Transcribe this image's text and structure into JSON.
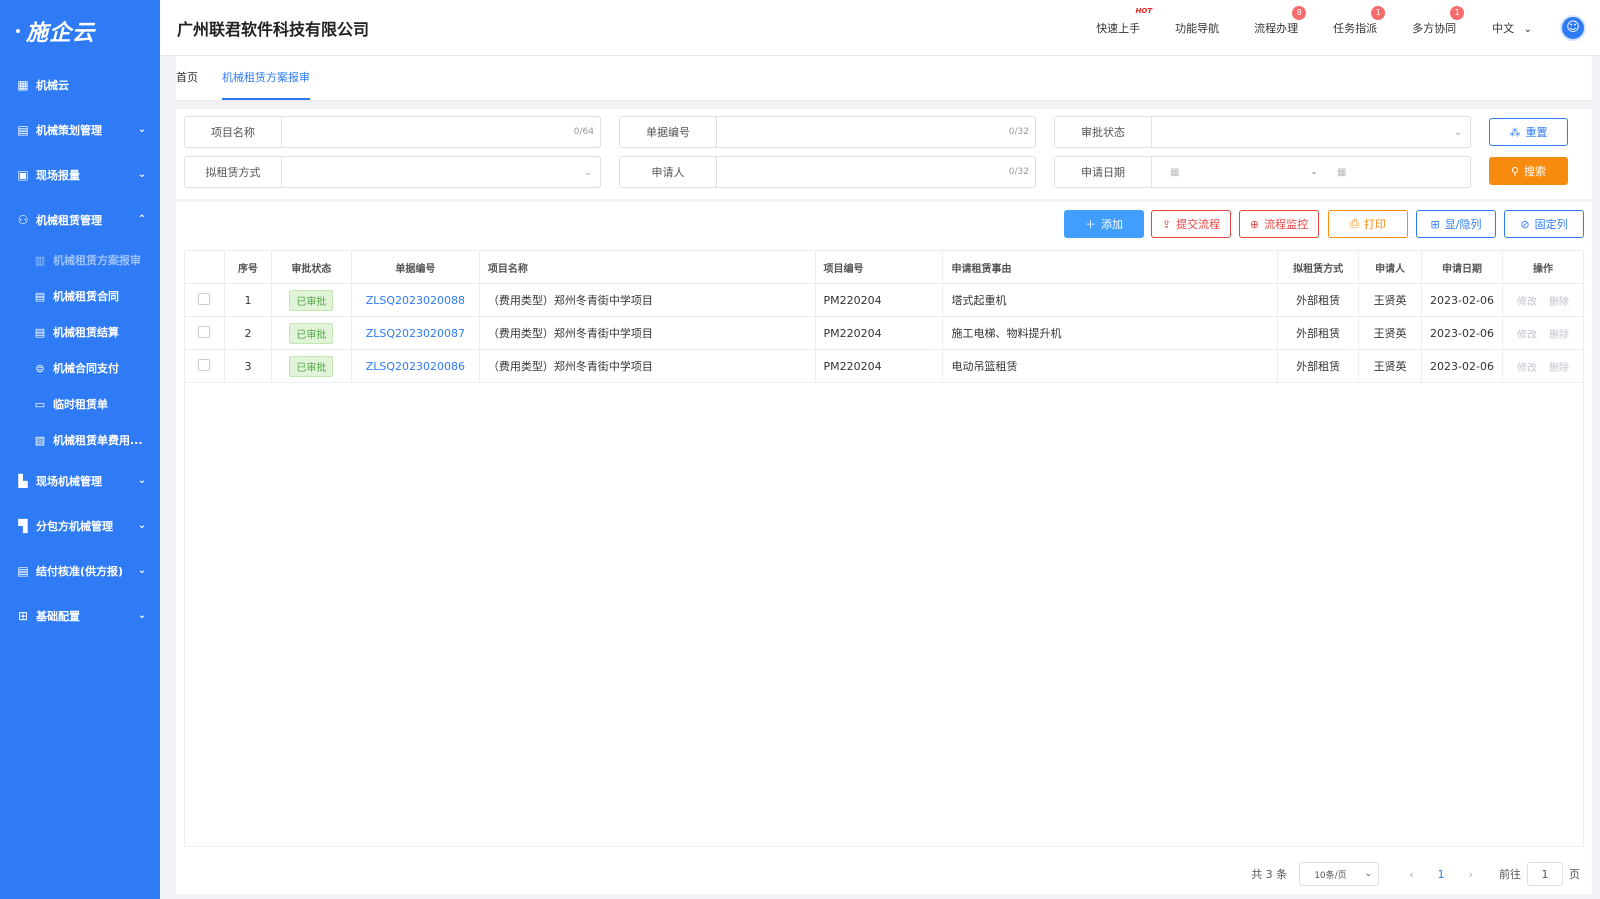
{
  "app": {
    "logo": "施企云",
    "company": "广州联君软件科技有限公司"
  },
  "header": {
    "nav": [
      {
        "label": "快速上手",
        "badge": "HOT"
      },
      {
        "label": "功能导航",
        "badge": ""
      },
      {
        "label": "流程办理",
        "badge": "8"
      },
      {
        "label": "任务指派",
        "badge": "1"
      },
      {
        "label": "多方协同",
        "badge": "1"
      }
    ],
    "lang": "中文"
  },
  "sidebar": {
    "items": [
      {
        "label": "机械云",
        "icon": "grid-icon"
      },
      {
        "label": "机械策划管理",
        "icon": "plan-icon"
      },
      {
        "label": "现场报量",
        "icon": "report-icon"
      },
      {
        "label": "机械租赁管理",
        "icon": "lease-icon"
      },
      {
        "label": "现场机械管理",
        "icon": "site-icon"
      },
      {
        "label": "分包方机械管理",
        "icon": "sub-icon"
      },
      {
        "label": "结付核准(供方报)",
        "icon": "settle-icon"
      },
      {
        "label": "基础配置",
        "icon": "config-icon"
      }
    ],
    "sub_items": [
      {
        "label": "机械租赁方案报审",
        "icon": "doc-icon"
      },
      {
        "label": "机械租赁合同",
        "icon": "contract-icon"
      },
      {
        "label": "机械租赁结算",
        "icon": "calc-icon"
      },
      {
        "label": "机械合同支付",
        "icon": "pay-icon"
      },
      {
        "label": "临时租赁单",
        "icon": "temp-icon"
      },
      {
        "label": "机械租赁单费用...",
        "icon": "fee-icon"
      }
    ]
  },
  "tabs": [
    "首页",
    "机械租赁方案报审"
  ],
  "filter": {
    "project_name": {
      "label": "项目名称",
      "count": "0/64"
    },
    "doc_no": {
      "label": "单据编号",
      "count": "0/32"
    },
    "status": {
      "label": "审批状态"
    },
    "lease_mode": {
      "label": "拟租赁方式"
    },
    "applicant": {
      "label": "申请人",
      "count": "0/32"
    },
    "apply_date": {
      "label": "申请日期",
      "separator": "-"
    },
    "reset_label": "重置",
    "search_label": "搜索"
  },
  "toolbar": {
    "add": "添加",
    "submit": "提交流程",
    "monitor": "流程监控",
    "print": "打印",
    "columns": "显/隐列",
    "fix": "固定列"
  },
  "table": {
    "headers": [
      "序号",
      "审批状态",
      "单据编号",
      "项目名称",
      "项目编号",
      "申请租赁事由",
      "拟租赁方式",
      "申请人",
      "申请日期",
      "操作"
    ],
    "rows": [
      {
        "no": "1",
        "status": "已审批",
        "doc": "ZLSQ2023020088",
        "project": "（费用类型）郑州冬青街中学项目",
        "code": "PM220204",
        "reason": "塔式起重机",
        "mode": "外部租赁",
        "applicant": "王贤英",
        "date": "2023-02-06",
        "edit": "修改",
        "del": "删除"
      },
      {
        "no": "2",
        "status": "已审批",
        "doc": "ZLSQ2023020087",
        "project": "（费用类型）郑州冬青街中学项目",
        "code": "PM220204",
        "reason": "施工电梯、物料提升机",
        "mode": "外部租赁",
        "applicant": "王贤英",
        "date": "2023-02-06",
        "edit": "修改",
        "del": "删除"
      },
      {
        "no": "3",
        "status": "已审批",
        "doc": "ZLSQ2023020086",
        "project": "（费用类型）郑州冬青街中学项目",
        "code": "PM220204",
        "reason": "电动吊篮租赁",
        "mode": "外部租赁",
        "applicant": "王贤英",
        "date": "2023-02-06",
        "edit": "修改",
        "del": "删除"
      }
    ]
  },
  "pager": {
    "total": "共 3 条",
    "size": "10条/页",
    "page": "1",
    "goto": "前往",
    "goto_value": "1",
    "unit": "页"
  },
  "colors": {
    "primary": "#2f7bf5",
    "orange": "#f78b0f",
    "danger": "#e64545"
  }
}
